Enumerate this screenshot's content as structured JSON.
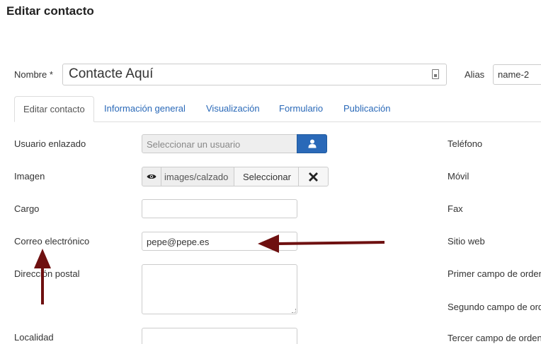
{
  "page": {
    "title": "Editar contacto"
  },
  "name": {
    "label": "Nombre *",
    "value": "Contacte Aquí"
  },
  "alias": {
    "label": "Alias",
    "value": "name-2"
  },
  "tabs": [
    {
      "label": "Editar contacto",
      "active": true
    },
    {
      "label": "Información general",
      "active": false
    },
    {
      "label": "Visualización",
      "active": false
    },
    {
      "label": "Formulario",
      "active": false
    },
    {
      "label": "Publicación",
      "active": false
    }
  ],
  "form": {
    "linked_user": {
      "label": "Usuario enlazado",
      "placeholder": "Seleccionar un usuario"
    },
    "image": {
      "label": "Imagen",
      "path": "images/calzado",
      "select_label": "Seleccionar"
    },
    "position": {
      "label": "Cargo",
      "value": ""
    },
    "email": {
      "label": "Correo electrónico",
      "value": "pepe@pepe.es"
    },
    "address": {
      "label": "Dirección postal",
      "value": ""
    },
    "city": {
      "label": "Localidad",
      "value": ""
    }
  },
  "right_column": {
    "phone": "Teléfono",
    "mobile": "Móvil",
    "fax": "Fax",
    "website": "Sitio web",
    "sort1": "Primer campo de orden",
    "sort2": "Segundo campo de orden",
    "sort3": "Tercer campo de orden"
  },
  "colors": {
    "accent": "#2a69b8",
    "annotation_arrow": "#6e1010"
  },
  "icons": {
    "name_field": "lock-icon",
    "user_button": "user-icon",
    "image_preview": "eye-icon",
    "image_clear": "close-icon"
  }
}
